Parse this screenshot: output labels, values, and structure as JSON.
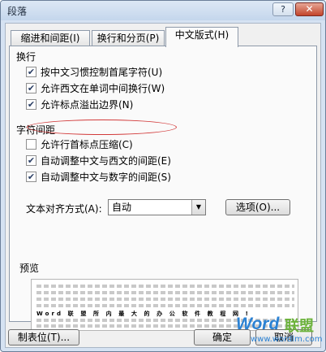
{
  "window": {
    "title": "段落",
    "help": "?",
    "close": "✕"
  },
  "tabs": [
    {
      "label": "缩进和间距(I)"
    },
    {
      "label": "换行和分页(P)"
    },
    {
      "label": "中文版式(H)"
    }
  ],
  "line_break": {
    "heading": "换行",
    "options": [
      {
        "label": "按中文习惯控制首尾字符(U)",
        "checked": true
      },
      {
        "label": "允许西文在单词中间换行(W)",
        "checked": true
      },
      {
        "label": "允许标点溢出边界(N)",
        "checked": true
      }
    ]
  },
  "char_spacing": {
    "heading": "字符间距",
    "options": [
      {
        "label": "允许行首标点压缩(C)",
        "checked": false
      },
      {
        "label": "自动调整中文与西文的间距(E)",
        "checked": true
      },
      {
        "label": "自动调整中文与数字的间距(S)",
        "checked": true
      }
    ]
  },
  "alignment": {
    "label": "文本对齐方式(A):",
    "value": "自动",
    "options_button": "选项(O)..."
  },
  "preview": {
    "heading": "预览",
    "sample": "Word 联 盟 所 内 最 大 的 办 公 软 件 教 程 网 !"
  },
  "footer": {
    "tab_stops": "制表位(T)...",
    "ok": "确定",
    "cancel": "取消"
  },
  "watermark": {
    "brand": "Word",
    "brand_cn": "联盟",
    "url": "www.wordlm.com"
  },
  "colors": {
    "titlebar": "#c4d6ec",
    "close": "#c2442b",
    "highlight": "#d23b3b",
    "brand": "#2b82d4"
  }
}
